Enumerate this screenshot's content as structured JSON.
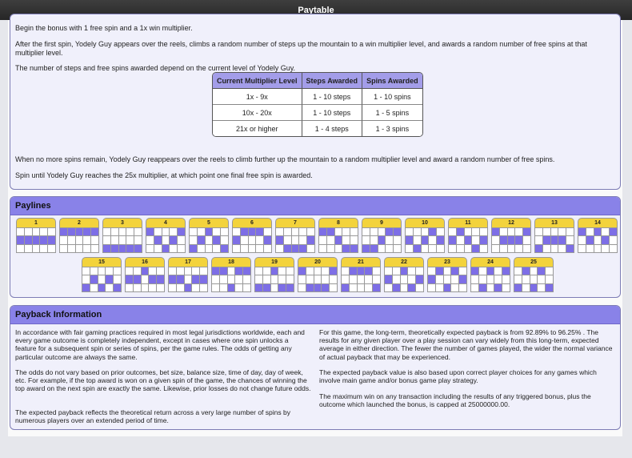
{
  "window": {
    "title": "Paytable"
  },
  "bonus": {
    "paragraphs": [
      "Begin the bonus with 1 free spin and a 1x win multiplier.",
      "After the first spin, Yodely Guy appears over the reels, climbs a random number of steps up the mountain to a win multiplier level, and awards a random number of free spins at that multiplier level.",
      "The number of steps and free spins awarded depend on the current level of Yodely Guy.",
      "When no more spins remain, Yodely Guy reappears over the reels to climb further up the mountain to a random multiplier level and award a random number of free spins.",
      "Spin until Yodely Guy reaches the 25x multiplier, at which point one final free spin is awarded."
    ],
    "table": {
      "headers": [
        "Current Multiplier Level",
        "Steps Awarded",
        "Spins Awarded"
      ],
      "rows": [
        [
          "1x - 9x",
          "1 - 10 steps",
          "1 - 10 spins"
        ],
        [
          "10x - 20x",
          "1 - 10 steps",
          "1 - 5 spins"
        ],
        [
          "21x or higher",
          "1 - 4 steps",
          "1 - 3 spins"
        ]
      ]
    }
  },
  "paylines": {
    "title": "Paylines",
    "lines": [
      {
        "label": "1",
        "rows": [
          1,
          1,
          1,
          1,
          1
        ]
      },
      {
        "label": "2",
        "rows": [
          0,
          0,
          0,
          0,
          0
        ]
      },
      {
        "label": "3",
        "rows": [
          2,
          2,
          2,
          2,
          2
        ]
      },
      {
        "label": "4",
        "rows": [
          0,
          1,
          2,
          1,
          0
        ]
      },
      {
        "label": "5",
        "rows": [
          2,
          1,
          0,
          1,
          2
        ]
      },
      {
        "label": "6",
        "rows": [
          1,
          0,
          0,
          0,
          1
        ]
      },
      {
        "label": "7",
        "rows": [
          1,
          2,
          2,
          2,
          1
        ]
      },
      {
        "label": "8",
        "rows": [
          0,
          0,
          1,
          2,
          2
        ]
      },
      {
        "label": "9",
        "rows": [
          2,
          2,
          1,
          0,
          0
        ]
      },
      {
        "label": "10",
        "rows": [
          1,
          2,
          1,
          0,
          1
        ]
      },
      {
        "label": "11",
        "rows": [
          1,
          0,
          1,
          2,
          1
        ]
      },
      {
        "label": "12",
        "rows": [
          0,
          1,
          1,
          1,
          0
        ]
      },
      {
        "label": "13",
        "rows": [
          2,
          1,
          1,
          1,
          2
        ]
      },
      {
        "label": "14",
        "rows": [
          0,
          1,
          0,
          1,
          0
        ]
      },
      {
        "label": "15",
        "rows": [
          2,
          1,
          2,
          1,
          2
        ]
      },
      {
        "label": "16",
        "rows": [
          1,
          1,
          0,
          1,
          1
        ]
      },
      {
        "label": "17",
        "rows": [
          1,
          1,
          2,
          1,
          1
        ]
      },
      {
        "label": "18",
        "rows": [
          0,
          0,
          2,
          0,
          0
        ]
      },
      {
        "label": "19",
        "rows": [
          2,
          2,
          0,
          2,
          2
        ]
      },
      {
        "label": "20",
        "rows": [
          0,
          2,
          2,
          2,
          0
        ]
      },
      {
        "label": "21",
        "rows": [
          2,
          0,
          0,
          0,
          2
        ]
      },
      {
        "label": "22",
        "rows": [
          1,
          2,
          0,
          2,
          1
        ]
      },
      {
        "label": "23",
        "rows": [
          1,
          0,
          2,
          0,
          1
        ]
      },
      {
        "label": "24",
        "rows": [
          0,
          2,
          0,
          2,
          0
        ]
      },
      {
        "label": "25",
        "rows": [
          2,
          0,
          2,
          0,
          2
        ]
      }
    ]
  },
  "payback": {
    "title": "Payback Information",
    "left": [
      "In accordance with fair gaming practices required in most legal jurisdictions worldwide, each and every game outcome is completely independent, except in cases where one spin unlocks a feature for a subsequent spin or series of spins, per the game rules. The odds of getting any particular outcome are always the same.",
      "The odds do not vary based on prior outcomes, bet size, balance size, time of day, day of week, etc. For example, if the top award is won on a given spin of the game, the chances of winning the top award on the next spin are exactly the same. Likewise, prior losses do not change future odds.",
      "The expected payback reflects the theoretical return across a very large number of spins by numerous players over an extended period of time."
    ],
    "right": [
      "For this game, the long-term, theoretically expected payback is from 92.89% to 96.25% . The results for any given player over a play session can vary widely from this long-term, expected average in either direction. The fewer the number of games played, the wider the normal variance of actual payback that may be experienced.",
      "The expected payback value is also based upon correct player choices for any games which involve main game and/or bonus game play strategy.",
      "The maximum win on any transaction including the results of any triggered bonus, plus the outcome which launched the bonus, is capped at 25000000.00."
    ]
  }
}
